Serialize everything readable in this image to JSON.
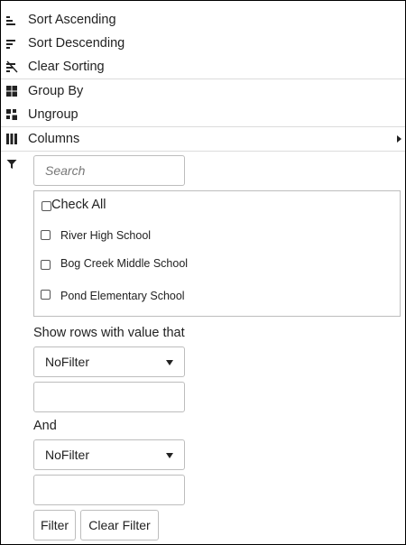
{
  "menu": {
    "sort_ascending": "Sort Ascending",
    "sort_descending": "Sort Descending",
    "clear_sorting": "Clear Sorting",
    "group_by": "Group By",
    "ungroup": "Ungroup",
    "columns": "Columns"
  },
  "filter": {
    "search_placeholder": "Search",
    "check_all": "Check All",
    "items": [
      "River High School",
      "Bog Creek Middle School",
      "Pond Elementary School"
    ],
    "condition_label": "Show rows with value that",
    "operator1": "NoFilter",
    "value1": "",
    "and_label": "And",
    "operator2": "NoFilter",
    "value2": "",
    "filter_button": "Filter",
    "clear_filter_button": "Clear Filter"
  },
  "icons": {
    "sort_ascending": "sort-ascending-icon",
    "sort_descending": "sort-descending-icon",
    "clear_sorting": "clear-sorting-icon",
    "group_by": "group-by-icon",
    "ungroup": "ungroup-icon",
    "columns": "columns-icon",
    "submenu_arrow": "chevron-right-icon",
    "filter": "filter-icon",
    "dropdown": "caret-down-icon"
  }
}
